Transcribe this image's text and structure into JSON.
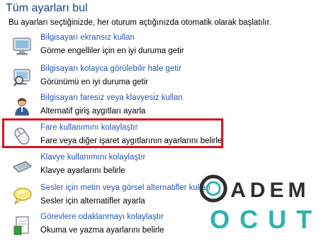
{
  "header": {
    "title": "Tüm ayarları bul",
    "description": "Bu ayarları seçtiğinizde, her oturum açtığınızda otomatik olarak başlatılır."
  },
  "options": [
    {
      "link": "Bilgisayarı ekransız kullan",
      "desc": "Görme engelliler için en iyi duruma getir",
      "icon": "monitor-icon"
    },
    {
      "link": "Bilgisayarı kolayca görülebilir hale getir",
      "desc": "Görünümü en iyi duruma getir",
      "icon": "monitor-magnifier-icon"
    },
    {
      "link": "Bilgisayarı faresiz veya klavyesiz kullan",
      "desc": "Alternatif giriş aygıtları ayarla",
      "icon": "person-icon"
    },
    {
      "link": "Fare kullanımını kolaylaştır",
      "desc": "Fare veya diğer işaret aygıtlarının ayarlarını belirle",
      "icon": "mouse-icon"
    },
    {
      "link": "Klavye kullanımını kolaylaştır",
      "desc": "Klavye ayarlarını belirle",
      "icon": "keyboard-icon"
    },
    {
      "link": "Sesler için metin veya görsel alternatifler kullan",
      "desc": "Sesler için alternatifler ayarla",
      "icon": "speech-bubble-icon"
    },
    {
      "link": "Görevlere odaklanmayı kolaylaştır",
      "desc": "Okuma ve yazma ayarlarını belirle",
      "icon": "document-icon"
    }
  ],
  "watermark": {
    "line1": "ADEM",
    "line2": "OCUT"
  },
  "colors": {
    "title": "#1e3f8a",
    "link": "#2a56b8",
    "highlight": "#d7141c",
    "watermark_ring": "#2f2f2f",
    "watermark_accent": "#2bb3b0"
  }
}
